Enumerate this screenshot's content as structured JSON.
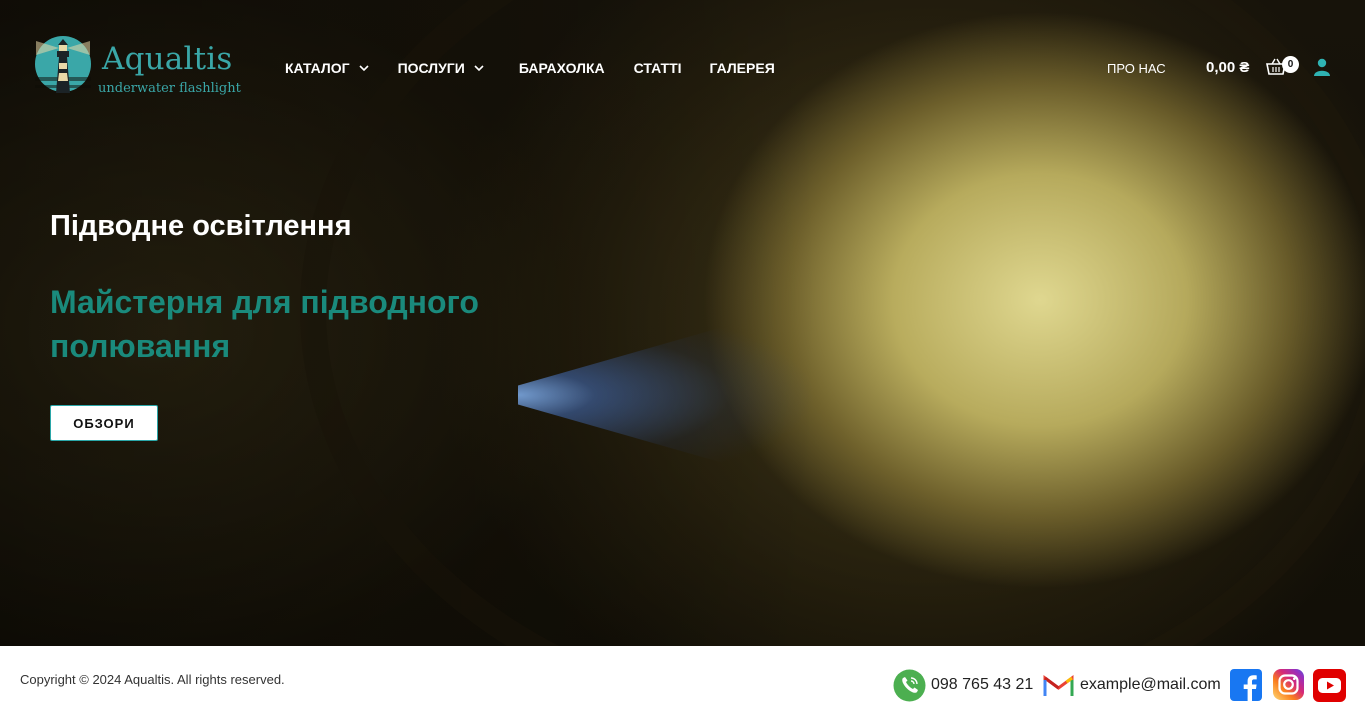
{
  "brand": {
    "name": "Aqualtis",
    "tagline": "underwater flashlight",
    "color": "#3aa7a8"
  },
  "nav": {
    "items": [
      {
        "label": "КАТАЛОГ",
        "has_dropdown": true
      },
      {
        "label": "ПОСЛУГИ",
        "has_dropdown": true
      },
      {
        "label": "БАРАХОЛКА",
        "has_dropdown": false
      },
      {
        "label": "СТАТТІ",
        "has_dropdown": false
      },
      {
        "label": "ГАЛЕРЕЯ",
        "has_dropdown": false
      }
    ],
    "about": "ПРО НАС",
    "cart_total": "0,00 ₴",
    "cart_count": "0",
    "icons": {
      "cart": "basket-icon",
      "user": "user-icon"
    }
  },
  "hero": {
    "subtitle": "Підводне освітлення",
    "title": "Майстерня для підводного полювання",
    "button": "ОБЗОРИ",
    "title_color": "#1a8a7c"
  },
  "footer": {
    "copyright": "Copyright © 2024 Aqualtis. All rights reserved.",
    "phone": "098 765 43 21",
    "email": "example@mail.com",
    "icons": [
      "phone-icon",
      "mail-icon",
      "facebook-icon",
      "instagram-icon",
      "youtube-icon"
    ]
  }
}
